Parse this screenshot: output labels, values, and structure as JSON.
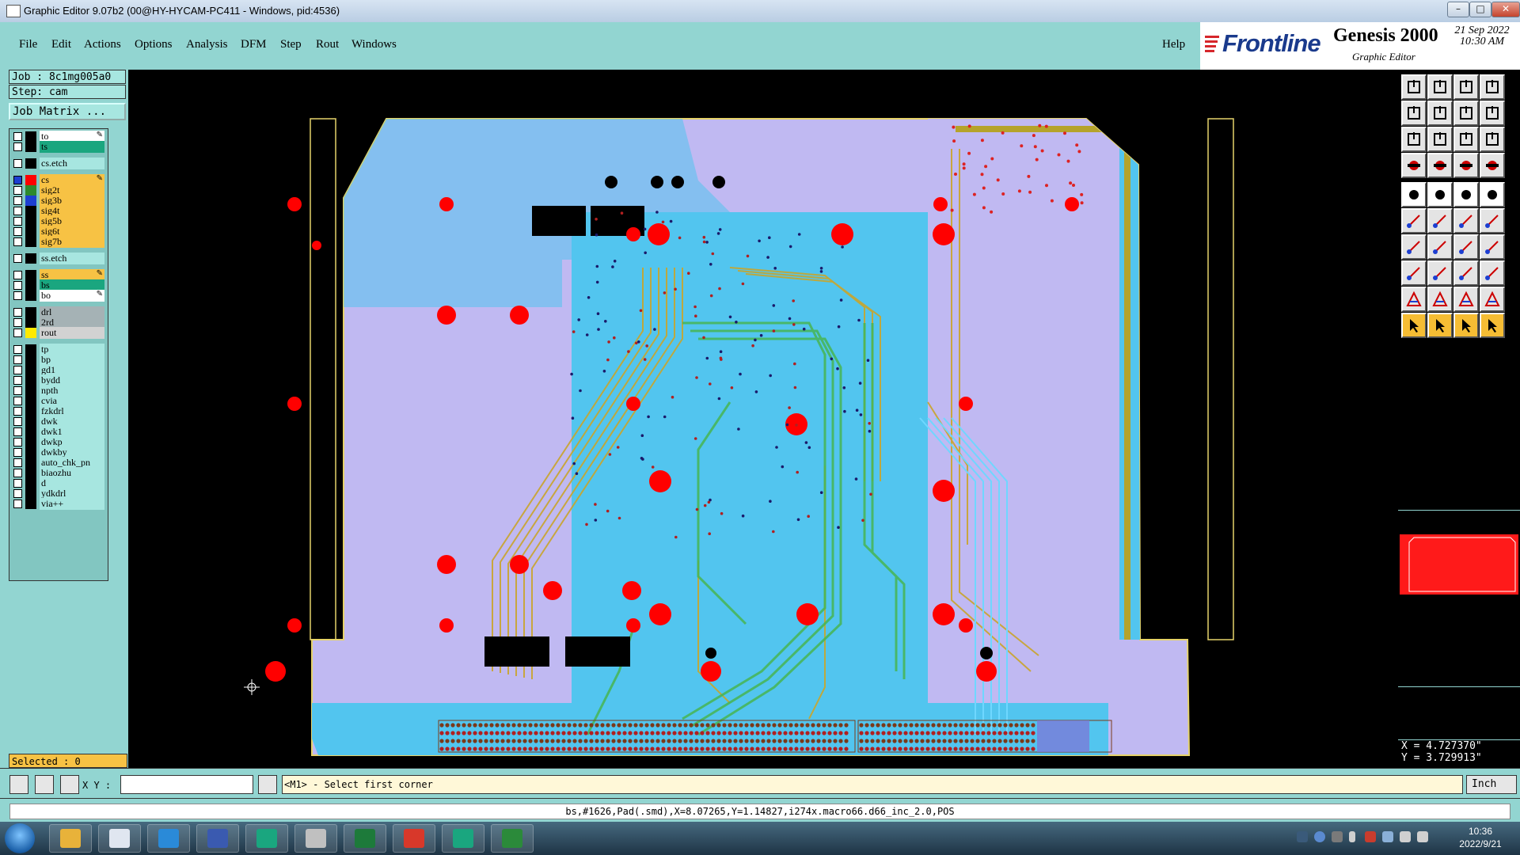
{
  "window": {
    "title": "Graphic Editor 9.07b2 (00@HY-HYCAM-PC411 - Windows, pid:4536)"
  },
  "menu": [
    "File",
    "Edit",
    "Actions",
    "Options",
    "Analysis",
    "DFM",
    "Step",
    "Rout",
    "Windows"
  ],
  "help_label": "Help",
  "brand": {
    "logo": "Frontline",
    "product": "Genesis 2000",
    "subtitle": "Graphic Editor",
    "date": "21 Sep 2022",
    "time": "10:30 AM"
  },
  "job": {
    "job_label": "Job : 8c1mg005a0",
    "step_label": "Step: cam",
    "matrix_label": "Job Matrix ..."
  },
  "colors": {
    "panel": "#92d5d1",
    "board_fill": "#c0b9f2",
    "copper": "#52c5ef",
    "pad": "#ff0000",
    "signal_trace": "#c9a52b",
    "inner_trace": "#47b552",
    "highlight": "#f7c244"
  },
  "layers": [
    {
      "name": "to",
      "chip": "#000000",
      "fill": "#ffffff",
      "edit": true
    },
    {
      "name": "ts",
      "chip": "#000000",
      "fill": "#1aa67f",
      "edit": false
    },
    {
      "name": "cs.etch",
      "chip": "#000000",
      "fill": "#a7e6e0",
      "edit": false
    },
    {
      "name": "cs",
      "chip": "#ff0000",
      "fill": "#f7c244",
      "edit": true,
      "active": true
    },
    {
      "name": "sig2t",
      "chip": "#2d8a2d",
      "fill": "#f7c244",
      "edit": false
    },
    {
      "name": "sig3b",
      "chip": "#1d3fd1",
      "fill": "#f7c244",
      "edit": false
    },
    {
      "name": "sig4t",
      "chip": "#000000",
      "fill": "#f7c244",
      "edit": false
    },
    {
      "name": "sig5b",
      "chip": "#000000",
      "fill": "#f7c244",
      "edit": false
    },
    {
      "name": "sig6t",
      "chip": "#000000",
      "fill": "#f7c244",
      "edit": false
    },
    {
      "name": "sig7b",
      "chip": "#000000",
      "fill": "#f7c244",
      "edit": false
    },
    {
      "name": "ss.etch",
      "chip": "#000000",
      "fill": "#a7e6e0",
      "edit": false
    },
    {
      "name": "ss",
      "chip": "#000000",
      "fill": "#f7c244",
      "edit": true
    },
    {
      "name": "bs",
      "chip": "#000000",
      "fill": "#1aa67f",
      "edit": false
    },
    {
      "name": "bo",
      "chip": "#000000",
      "fill": "#ffffff",
      "edit": true
    },
    {
      "name": "drl",
      "chip": "#000000",
      "fill": "#a5b2b5",
      "edit": false
    },
    {
      "name": "2rd",
      "chip": "#000000",
      "fill": "#a5b2b5",
      "edit": false
    },
    {
      "name": "rout",
      "chip": "#ffea00",
      "fill": "#d2d2d2",
      "edit": false
    },
    {
      "name": "tp",
      "chip": "#000000",
      "fill": "#a7e6e0",
      "edit": false
    },
    {
      "name": "bp",
      "chip": "#000000",
      "fill": "#a7e6e0",
      "edit": false
    },
    {
      "name": "gd1",
      "chip": "#000000",
      "fill": "#a7e6e0",
      "edit": false
    },
    {
      "name": "bydd",
      "chip": "#000000",
      "fill": "#a7e6e0",
      "edit": false
    },
    {
      "name": "npth",
      "chip": "#000000",
      "fill": "#a7e6e0",
      "edit": false
    },
    {
      "name": "cvia",
      "chip": "#000000",
      "fill": "#a7e6e0",
      "edit": false
    },
    {
      "name": "fzkdrl",
      "chip": "#000000",
      "fill": "#a7e6e0",
      "edit": false
    },
    {
      "name": "dwk",
      "chip": "#000000",
      "fill": "#a7e6e0",
      "edit": false
    },
    {
      "name": "dwk1",
      "chip": "#000000",
      "fill": "#a7e6e0",
      "edit": false
    },
    {
      "name": "dwkp",
      "chip": "#000000",
      "fill": "#a7e6e0",
      "edit": false
    },
    {
      "name": "dwkby",
      "chip": "#000000",
      "fill": "#a7e6e0",
      "edit": false
    },
    {
      "name": "auto_chk_pn",
      "chip": "#000000",
      "fill": "#a7e6e0",
      "edit": false
    },
    {
      "name": "biaozhu",
      "chip": "#000000",
      "fill": "#a7e6e0",
      "edit": false
    },
    {
      "name": "d",
      "chip": "#000000",
      "fill": "#a7e6e0",
      "edit": false
    },
    {
      "name": "ydkdrl",
      "chip": "#000000",
      "fill": "#a7e6e0",
      "edit": false
    },
    {
      "name": "via++",
      "chip": "#000000",
      "fill": "#a7e6e0",
      "edit": false
    }
  ],
  "selected_label": "Selected : 0",
  "coords": {
    "x": "X = 4.727370\"",
    "y": "Y = 3.729913\""
  },
  "cmd": {
    "xy_label": "X Y :",
    "input_value": "",
    "prompt": "<M1> - Select first corner",
    "units": "Inch"
  },
  "status": "bs,#1626,Pad(.smd),X=8.07265,Y=1.14827,i274x.macro66.d66_inc_2.0,POS",
  "clock": {
    "time": "10:36",
    "date": "2022/9/21"
  },
  "taskbar_apps": [
    "shell-icon",
    "notepad-icon",
    "arrow-app-icon",
    "floppy-icon",
    "genesis-eye-icon",
    "xmanager-icon",
    "excel-icon",
    "cam-red-icon",
    "genesis-eye2-icon",
    "green-p-icon"
  ]
}
